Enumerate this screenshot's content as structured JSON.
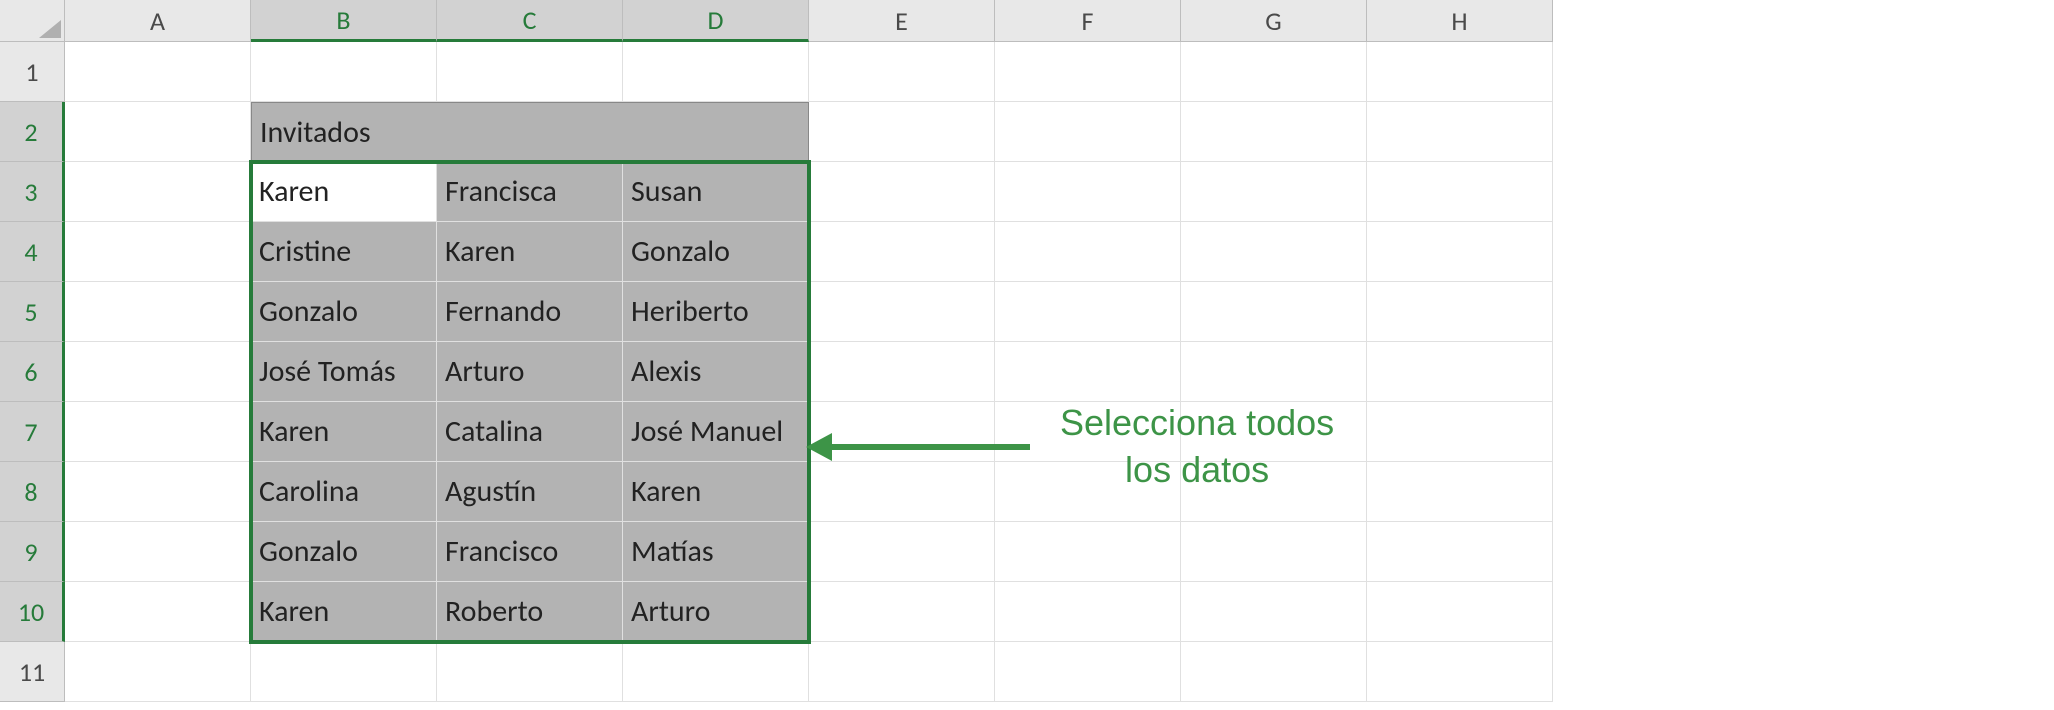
{
  "columns": [
    "A",
    "B",
    "C",
    "D",
    "E",
    "F",
    "G",
    "H"
  ],
  "rows": [
    "1",
    "2",
    "3",
    "4",
    "5",
    "6",
    "7",
    "8",
    "9",
    "10",
    "11"
  ],
  "selected_columns": [
    "B",
    "C",
    "D"
  ],
  "selected_rows": [
    "2",
    "3",
    "4",
    "5",
    "6",
    "7",
    "8",
    "9",
    "10"
  ],
  "table_header": "Invitados",
  "data": {
    "B3": "Karen",
    "C3": "Francisca",
    "D3": "Susan",
    "B4": "Cristine",
    "C4": "Karen",
    "D4": "Gonzalo",
    "B5": "Gonzalo",
    "C5": "Fernando",
    "D5": "Heriberto",
    "B6": "José Tomás",
    "C6": "Arturo",
    "D6": "Alexis",
    "B7": "Karen",
    "C7": "Catalina",
    "D7": "José Manuel",
    "B8": "Carolina",
    "C8": "Agustín",
    "D8": "Karen",
    "B9": "Gonzalo",
    "C9": "Francisco",
    "D9": "Matías",
    "B10": "Karen",
    "C10": "Roberto",
    "D10": "Arturo"
  },
  "active_cell": "B3",
  "annotation": {
    "line1": "Selecciona todos",
    "line2": "los datos"
  },
  "colors": {
    "selection_green": "#267b3a",
    "annotation_green": "#3d9447",
    "header_bg": "#e8e8e8",
    "selected_header_bg": "#d2d2d2",
    "selected_cell_bg": "#b3b3b3",
    "merged_header_bg": "#eaeef5"
  }
}
